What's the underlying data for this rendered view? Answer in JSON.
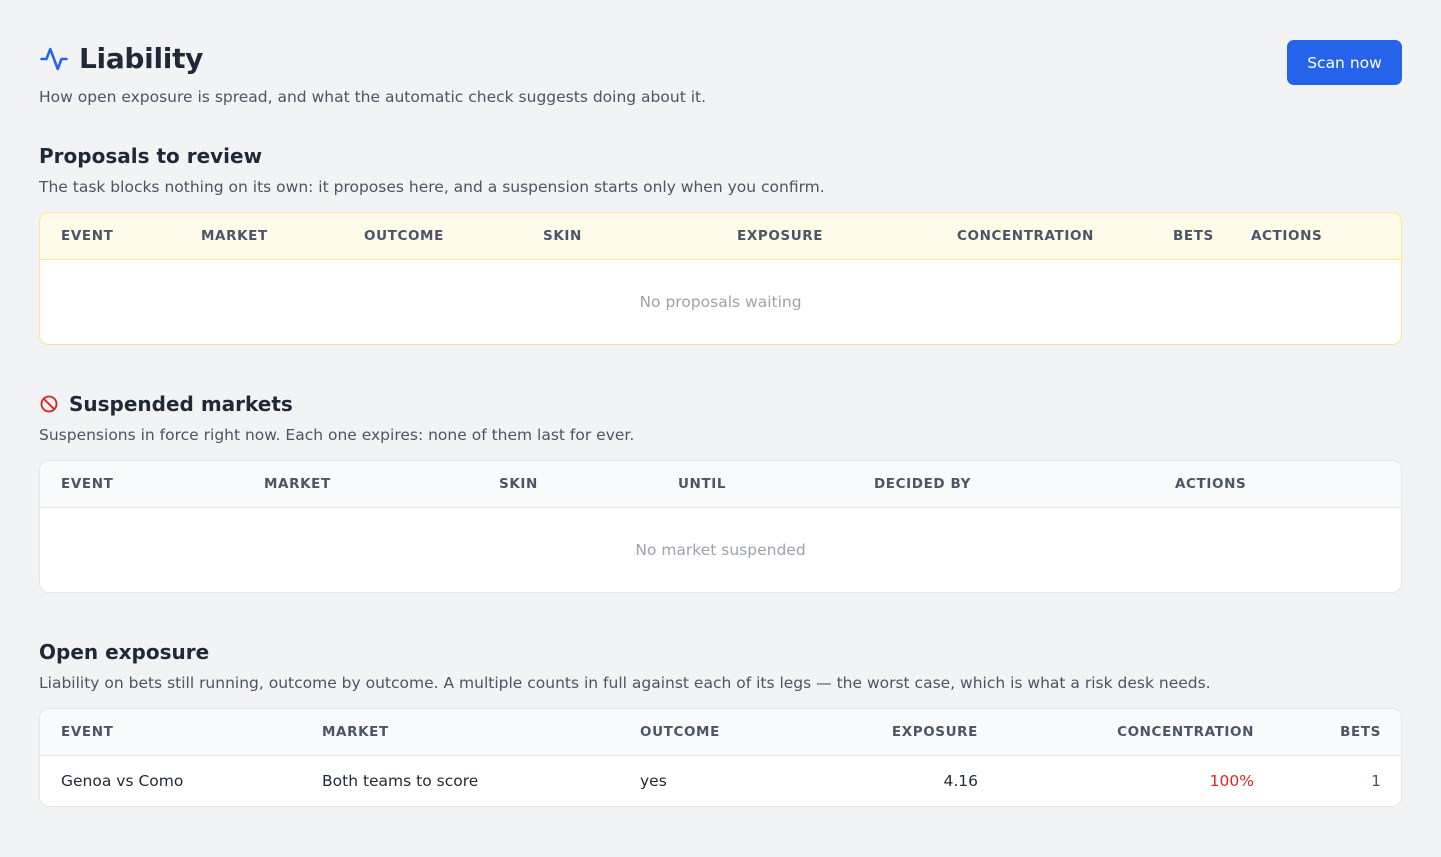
{
  "header": {
    "title": "Liability",
    "subtitle": "How open exposure is spread, and what the automatic check suggests doing about it.",
    "scan_button": "Scan now"
  },
  "proposals": {
    "title": "Proposals to review",
    "description": "The task blocks nothing on its own: it proposes here, and a suspension starts only when you confirm.",
    "columns": [
      "EVENT",
      "MARKET",
      "OUTCOME",
      "SKIN",
      "EXPOSURE",
      "CONCENTRATION",
      "BETS",
      "ACTIONS"
    ],
    "empty": "No proposals waiting"
  },
  "suspended": {
    "title": "Suspended markets",
    "description": "Suspensions in force right now. Each one expires: none of them last for ever.",
    "columns": [
      "EVENT",
      "MARKET",
      "SKIN",
      "UNTIL",
      "DECIDED BY",
      "ACTIONS"
    ],
    "empty": "No market suspended"
  },
  "exposure": {
    "title": "Open exposure",
    "description": "Liability on bets still running, outcome by outcome. A multiple counts in full against each of its legs — the worst case, which is what a risk desk needs.",
    "columns": [
      "EVENT",
      "MARKET",
      "OUTCOME",
      "EXPOSURE",
      "CONCENTRATION",
      "BETS"
    ],
    "rows": [
      {
        "event": "Genoa vs Como",
        "market": "Both teams to score",
        "outcome": "yes",
        "exposure": "4.16",
        "concentration": "100%",
        "bets": "1"
      }
    ]
  },
  "colors": {
    "accent": "#2563eb",
    "danger": "#dc2626",
    "warning_bg": "#fefbeb",
    "warning_border": "#fde68a"
  },
  "icons": {
    "title": "activity-icon",
    "suspended": "ban-icon"
  }
}
